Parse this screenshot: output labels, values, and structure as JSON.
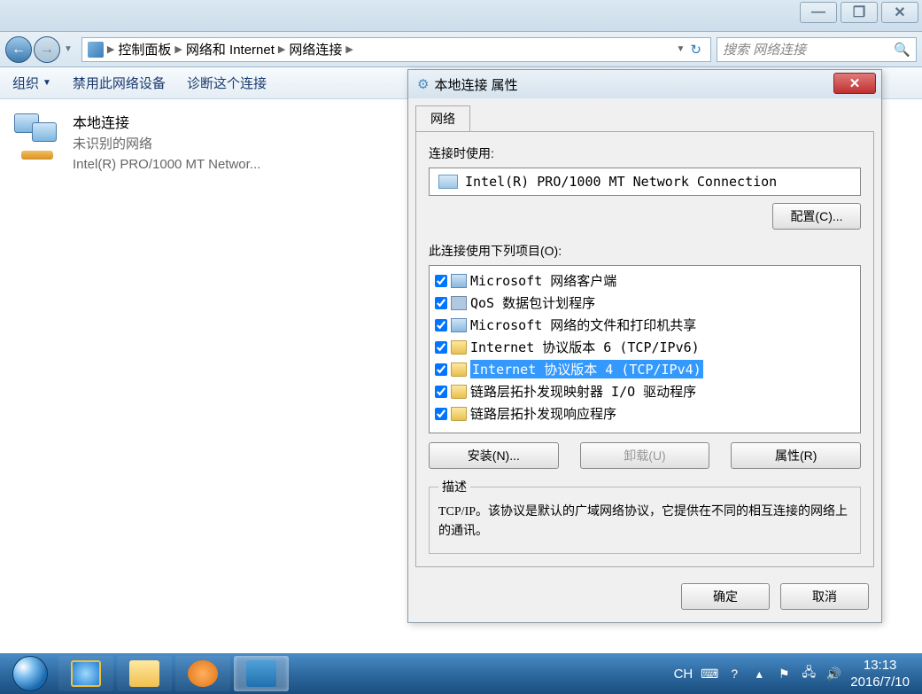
{
  "window_controls": {
    "minimize": "—",
    "maximize": "❐",
    "close": "✕"
  },
  "breadcrumb": {
    "items": [
      "控制面板",
      "网络和 Internet",
      "网络连接"
    ]
  },
  "search": {
    "placeholder": "搜索 网络连接"
  },
  "toolbar": {
    "organize": "组织",
    "disable": "禁用此网络设备",
    "diagnose": "诊断这个连接"
  },
  "connection": {
    "title": "本地连接",
    "status": "未识别的网络",
    "adapter": "Intel(R) PRO/1000 MT Networ..."
  },
  "dialog": {
    "title": "本地连接 属性",
    "tab": "网络",
    "use_label": "连接时使用:",
    "adapter": "Intel(R) PRO/1000 MT Network Connection",
    "configure_btn": "配置(C)...",
    "items_label": "此连接使用下列项目(O):",
    "items": [
      {
        "label": "Microsoft 网络客户端",
        "icon": "client",
        "checked": true,
        "selected": false
      },
      {
        "label": "QoS 数据包计划程序",
        "icon": "qos",
        "checked": true,
        "selected": false
      },
      {
        "label": "Microsoft 网络的文件和打印机共享",
        "icon": "client",
        "checked": true,
        "selected": false
      },
      {
        "label": "Internet 协议版本 6 (TCP/IPv6)",
        "icon": "proto",
        "checked": true,
        "selected": false
      },
      {
        "label": "Internet 协议版本 4 (TCP/IPv4)",
        "icon": "proto",
        "checked": true,
        "selected": true
      },
      {
        "label": "链路层拓扑发现映射器 I/O 驱动程序",
        "icon": "proto",
        "checked": true,
        "selected": false
      },
      {
        "label": "链路层拓扑发现响应程序",
        "icon": "proto",
        "checked": true,
        "selected": false
      }
    ],
    "install_btn": "安装(N)...",
    "uninstall_btn": "卸载(U)",
    "properties_btn": "属性(R)",
    "desc_legend": "描述",
    "desc_text": "TCP/IP。该协议是默认的广域网络协议，它提供在不同的相互连接的网络上的通讯。",
    "ok_btn": "确定",
    "cancel_btn": "取消"
  },
  "tray": {
    "lang": "CH",
    "time": "13:13",
    "date": "2016/7/10"
  }
}
